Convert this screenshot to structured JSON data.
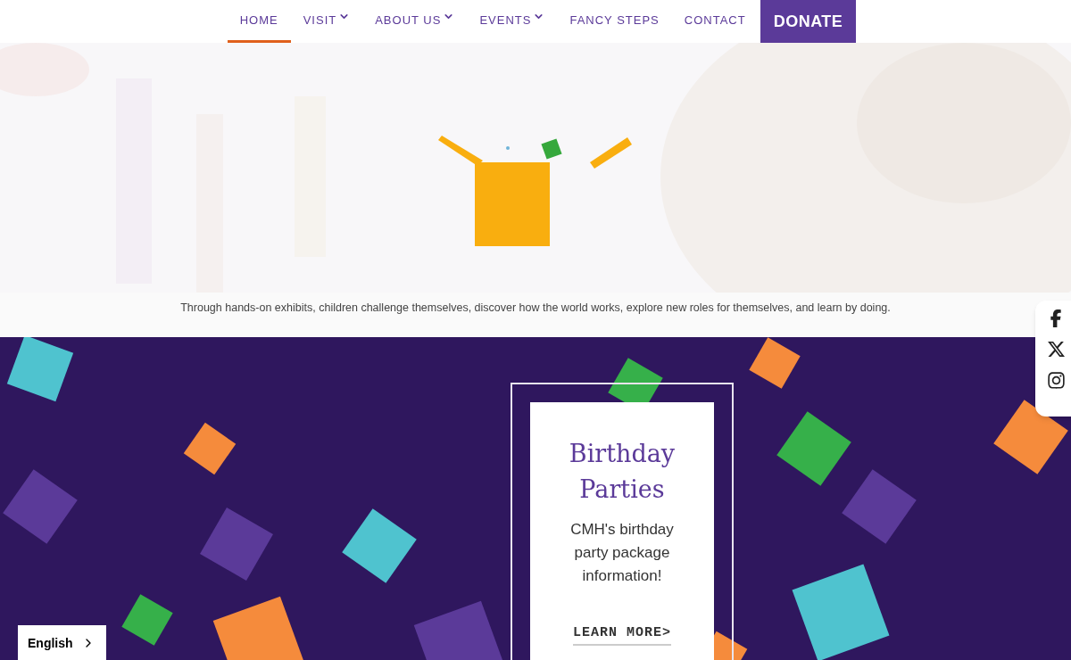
{
  "nav": {
    "items": [
      {
        "label": "HOME",
        "selected": true,
        "dropdown": false
      },
      {
        "label": "VISIT",
        "selected": false,
        "dropdown": true
      },
      {
        "label": "ABOUT US",
        "selected": false,
        "dropdown": true
      },
      {
        "label": "EVENTS",
        "selected": false,
        "dropdown": true
      },
      {
        "label": "FANCY STEPS",
        "selected": false,
        "dropdown": false
      },
      {
        "label": "CONTACT",
        "selected": false,
        "dropdown": false
      }
    ],
    "donate": "DONATE"
  },
  "hero": {
    "kind": "picture",
    "caption": "Through hands-on exhibits, children challenge themselves, discover how the world works, explore new roles for themselves, and learn by doing."
  },
  "card": {
    "title": "Birthday Parties",
    "text": "CMH's birthday party package information!",
    "link": "LEARN MORE>"
  },
  "language": {
    "label": "English"
  }
}
